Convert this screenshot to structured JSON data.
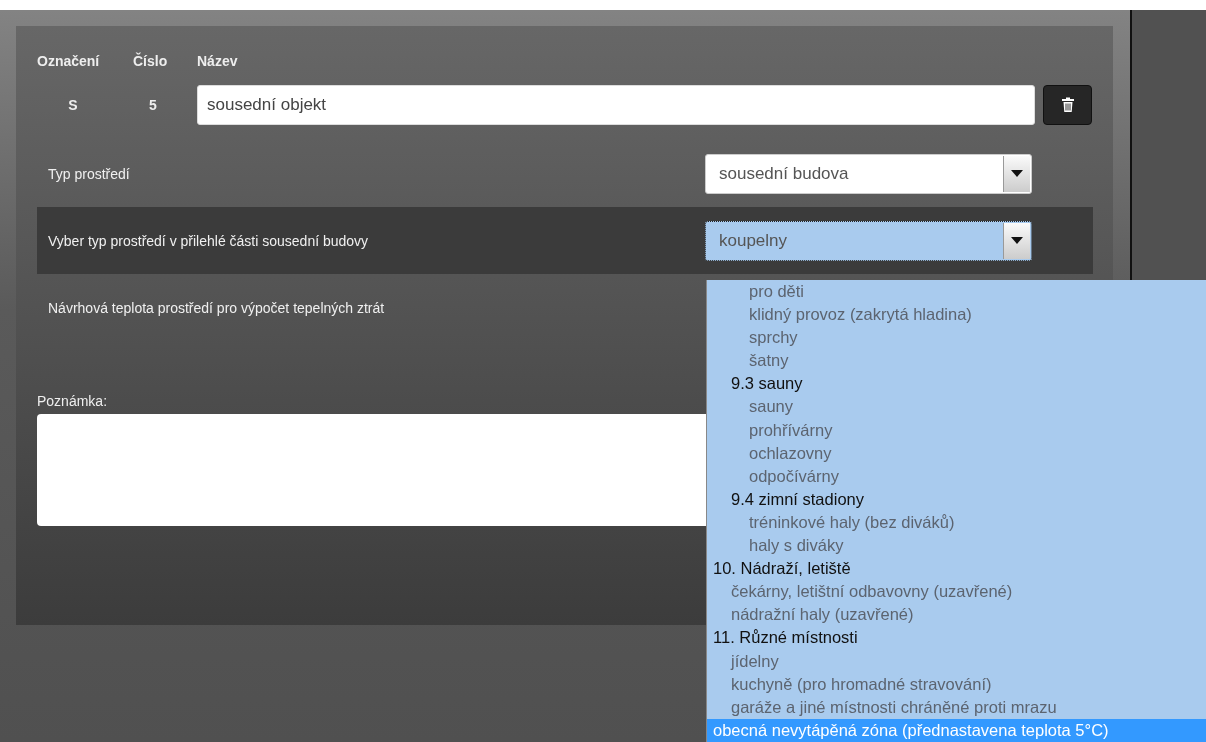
{
  "header": {
    "columns": [
      "Označení",
      "Číslo",
      "Název"
    ]
  },
  "object": {
    "mark": "S",
    "number": "5",
    "name": "sousední objekt"
  },
  "fields": [
    {
      "label": "Typ prostředí",
      "value": "sousední budova",
      "highlighted": false,
      "focused": false
    },
    {
      "label": "Vyber typ prostředí v přilehlé části sousední budovy",
      "value": "koupelny",
      "highlighted": true,
      "focused": true
    },
    {
      "label": "Návrhová teplota prostředí pro výpočet tepelných ztrát"
    }
  ],
  "note": {
    "label": "Poznámka:"
  },
  "dropdown": {
    "options": [
      {
        "children": [
          {
            "children": [
              {
                "label": "pro děti",
                "selected": false
              },
              {
                "label": "klidný provoz (zakrytá hladina)",
                "selected": false
              },
              {
                "label": "sprchy",
                "selected": false
              },
              {
                "label": "šatny",
                "selected": false
              }
            ]
          },
          {
            "label": "9.3 sauny",
            "selected": false,
            "children": [
              {
                "label": "sauny",
                "selected": false
              },
              {
                "label": "prohřívárny",
                "selected": false
              },
              {
                "label": "ochlazovny",
                "selected": false
              },
              {
                "label": "odpočívárny",
                "selected": false
              }
            ]
          },
          {
            "label": "9.4 zimní stadiony",
            "selected": false,
            "children": [
              {
                "label": "tréninkové haly (bez diváků)",
                "selected": false
              },
              {
                "label": "haly s diváky",
                "selected": false
              }
            ]
          }
        ]
      },
      {
        "label": "10. Nádraží, letiště",
        "selected": false,
        "children": [
          {
            "label": "čekárny, letištní odbavovny (uzavřené)",
            "selected": false
          },
          {
            "label": "nádražní haly (uzavřené)",
            "selected": false
          }
        ]
      },
      {
        "label": "11. Různé místnosti",
        "selected": false,
        "children": [
          {
            "label": "jídelny",
            "selected": false
          },
          {
            "label": "kuchyně (pro hromadné stravování)",
            "selected": false
          },
          {
            "label": "garáže a jiné místnosti chráněné proti mrazu",
            "selected": false
          }
        ]
      },
      {
        "label": "obecná nevytápěná zóna (přednastavena teplota 5°C)",
        "selected": true
      }
    ]
  }
}
